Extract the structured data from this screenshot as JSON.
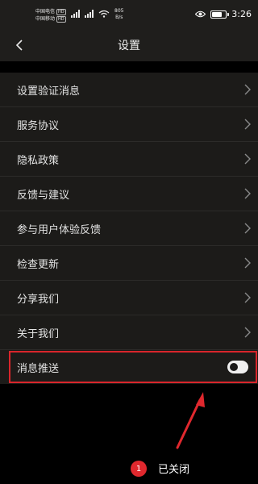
{
  "status_bar": {
    "carrier_1": "中国电信",
    "carrier_2": "中国移动",
    "hd_badge": "HD",
    "net_speed_value": "805",
    "net_speed_unit": "B/s",
    "time": "3:26",
    "battery_level": 0.8
  },
  "header": {
    "title": "设置",
    "back_icon": "chevron-left-icon"
  },
  "settings": {
    "items": [
      {
        "label": "设置验证消息"
      },
      {
        "label": "服务协议"
      },
      {
        "label": "隐私政策"
      },
      {
        "label": "反馈与建议"
      },
      {
        "label": "参与用户体验反馈"
      },
      {
        "label": "检查更新"
      },
      {
        "label": "分享我们"
      },
      {
        "label": "关于我们"
      }
    ],
    "push": {
      "label": "消息推送",
      "enabled": false
    }
  },
  "annotation": {
    "step_number": "1",
    "caption": "已关闭",
    "highlight_color": "#d9252b"
  }
}
